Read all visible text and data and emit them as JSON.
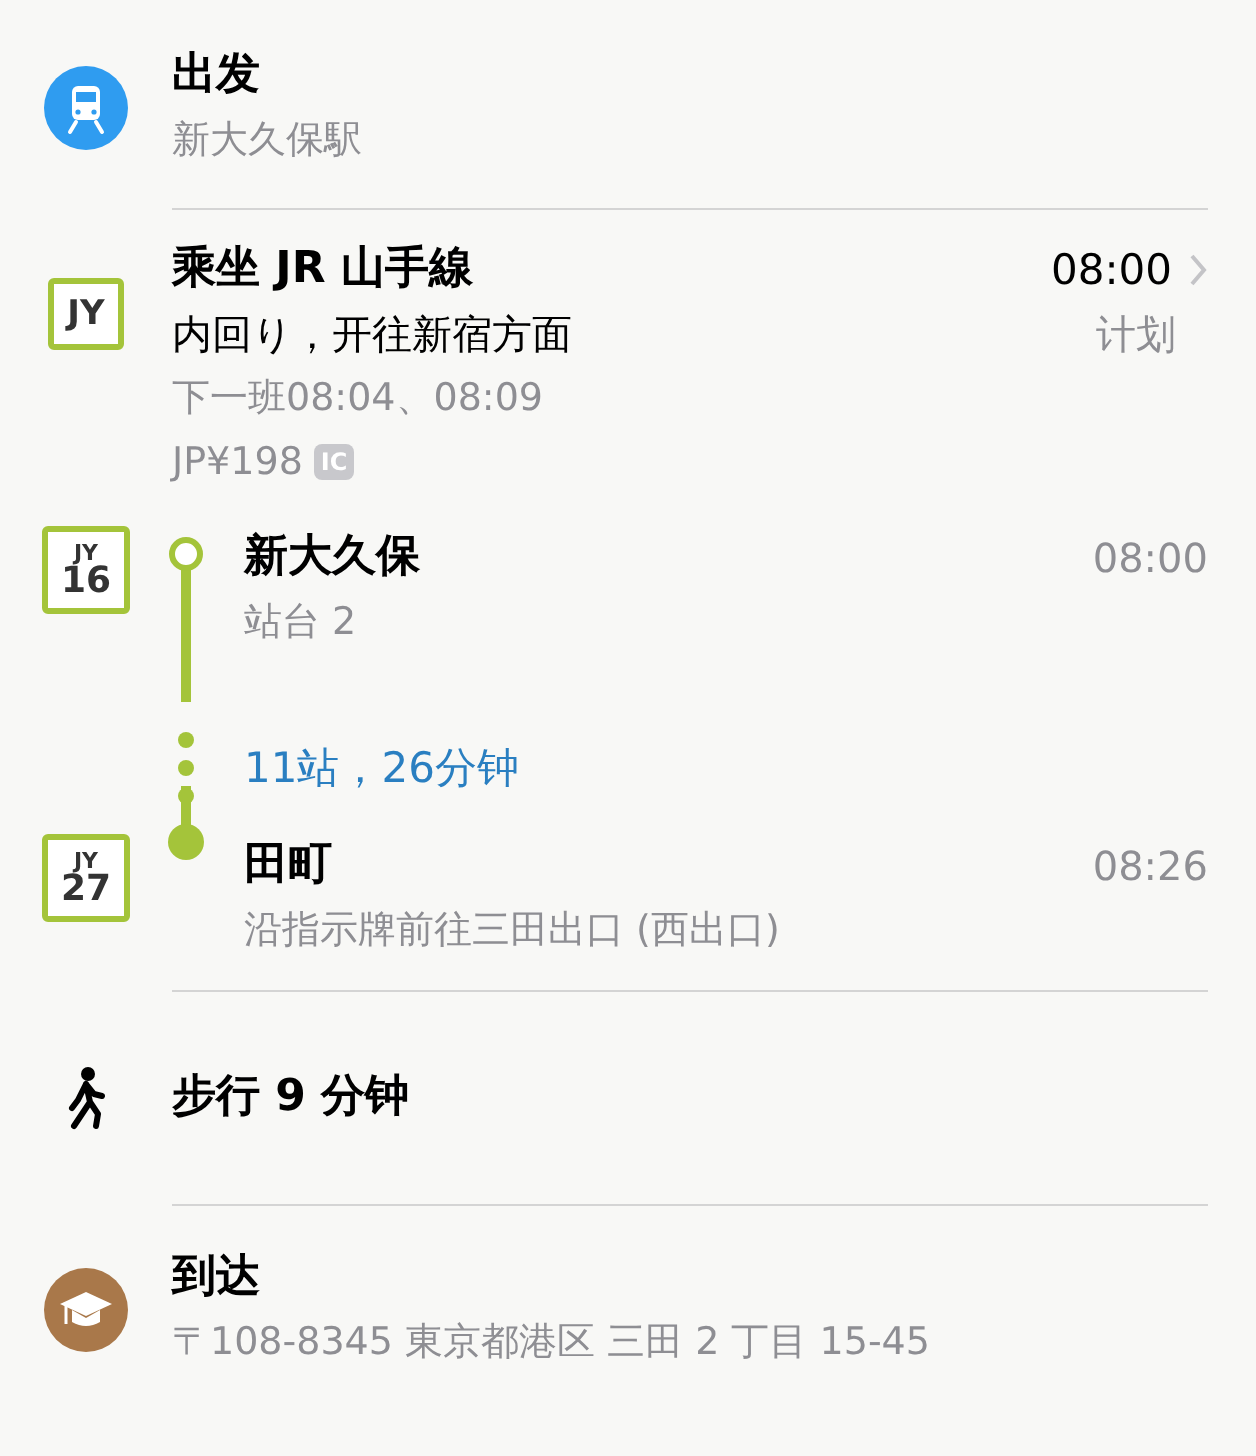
{
  "departure": {
    "title": "出发",
    "station": "新大久保駅"
  },
  "ride": {
    "line_code": "JY",
    "title": "乘坐 JR 山手線",
    "direction": "内回り，开往新宿方面",
    "next": "下一班08:04、08:09",
    "fare": "JP¥198",
    "fare_tag": "IC",
    "time": "08:00",
    "time_note": "计划"
  },
  "stops": [
    {
      "kind": "start",
      "line_code": "JY",
      "number": "16",
      "name": "新大久保",
      "detail": "站台 2",
      "time": "08:00"
    },
    {
      "kind": "summary",
      "text": "11站，26分钟"
    },
    {
      "kind": "end",
      "line_code": "JY",
      "number": "27",
      "name": "田町",
      "detail": "沿指示牌前往三田出口 (西出口)",
      "time": "08:26"
    }
  ],
  "walk": {
    "text": "步行 9 分钟"
  },
  "arrival": {
    "title": "到达",
    "address": "〒108-8345 東京都港区 三田 2 丁目 15-45"
  }
}
